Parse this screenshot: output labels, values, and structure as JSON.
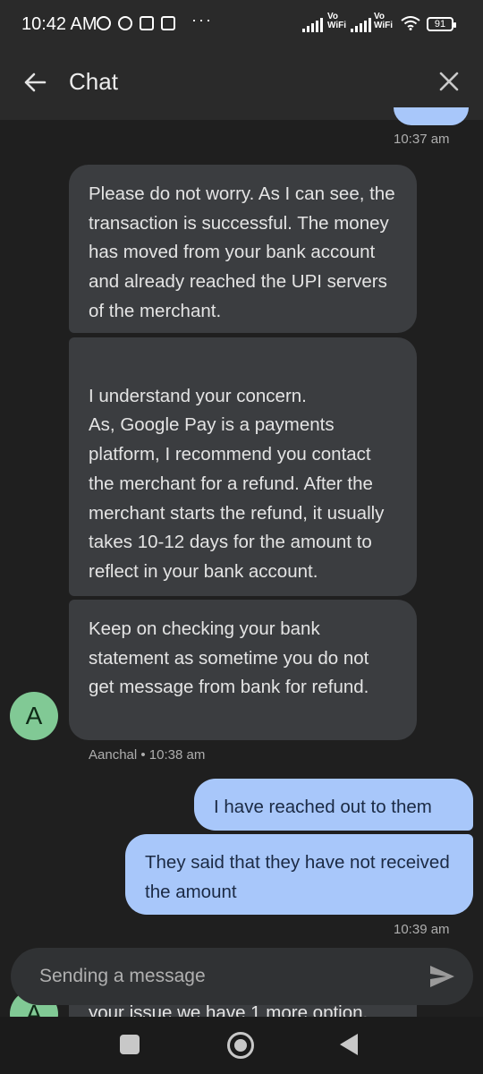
{
  "status_bar": {
    "time": "10:42 AM",
    "dots": "···",
    "sim1_label": "Vo WiFi",
    "sim2_label": "Vo WiFi",
    "battery": "91"
  },
  "header": {
    "title": "Chat",
    "back_icon": "arrow-left-icon",
    "close_icon": "close-icon"
  },
  "conversation": {
    "top_partial_time": "10:37 am",
    "agent_messages": [
      "Please do not worry. As I can see, the transaction is successful. The money has moved from your bank account and already reached the UPI servers of the merchant.",
      "I understand your concern.\nAs, Google Pay is a payments platform, I recommend you contact the merchant for a refund. After the merchant starts the refund, it usually takes 10-12 days for the amount to reflect in your bank account.",
      "Keep on checking your bank statement as sometime you do not get message from bank for refund."
    ],
    "agent_avatar_letter": "A",
    "agent_meta": "Aanchal • 10:38 am",
    "user_messages": [
      "I have reached out to them",
      "They said that they have not received the amount"
    ],
    "user_time": "10:39 am",
    "partial_agent_message": "your issue we have 1 more option."
  },
  "composer": {
    "placeholder": "Sending a message",
    "send_icon": "send-icon"
  },
  "colors": {
    "background": "#1f1f1f",
    "agent_bubble": "#3b3d40",
    "user_bubble": "#a8c7fa",
    "avatar": "#81c995"
  }
}
